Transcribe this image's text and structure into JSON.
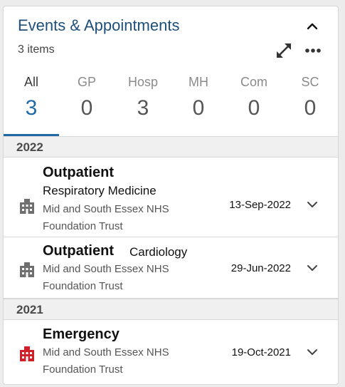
{
  "header": {
    "title": "Events & Appointments",
    "item_count": "3 items"
  },
  "tabs": [
    {
      "label": "All",
      "count": "3"
    },
    {
      "label": "GP",
      "count": "0"
    },
    {
      "label": "Hosp",
      "count": "3"
    },
    {
      "label": "MH",
      "count": "0"
    },
    {
      "label": "Com",
      "count": "0"
    },
    {
      "label": "SC",
      "count": "0"
    }
  ],
  "groups": [
    {
      "year": "2022"
    },
    {
      "year": "2021"
    }
  ],
  "events": [
    {
      "type": "Outpatient",
      "specialty": "Respiratory Medicine",
      "org_line1": "Mid and South Essex NHS",
      "org_line2": "Foundation Trust",
      "date": "13-Sep-2022",
      "icon_color": "#6f6f6f"
    },
    {
      "type": "Outpatient",
      "specialty": "Cardiology",
      "org_line1": "Mid and South Essex NHS",
      "org_line2": "Foundation Trust",
      "date": "29-Jun-2022",
      "icon_color": "#6f6f6f"
    },
    {
      "type": "Emergency",
      "specialty": "",
      "org_line1": "Mid and South Essex NHS",
      "org_line2": "Foundation Trust",
      "date": "19-Oct-2021",
      "icon_color": "#d0202a"
    }
  ],
  "icons": {
    "collapse": "chevron-up-icon",
    "expand": "expand-icon",
    "more": "more-icon",
    "hospital": "hospital-building-icon",
    "row_toggle": "chevron-down-icon"
  },
  "colors": {
    "accent": "#1f6aa5",
    "title": "#1c4f7a",
    "emergency": "#d0202a"
  }
}
